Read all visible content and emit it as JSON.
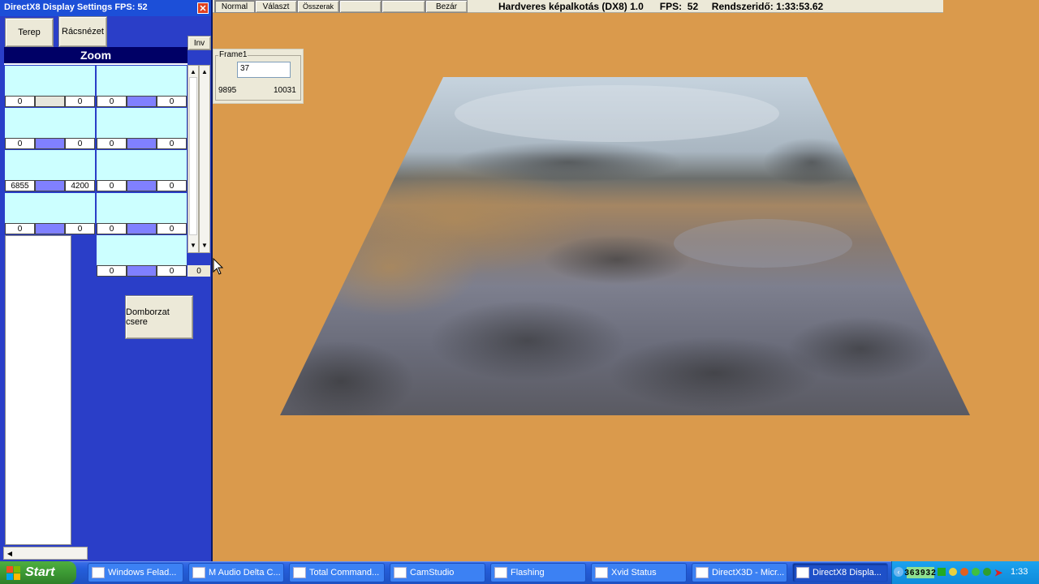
{
  "settings_window": {
    "title": "DirectX8 Display Settings FPS:  52",
    "btn_terep": "Terep",
    "btn_racsnezet": "Rácsnézet",
    "btn_inv": "Inv",
    "zoom_header": "Zoom",
    "rows": [
      [
        "0",
        "0",
        "0",
        "0"
      ],
      [
        "0",
        "0",
        "0",
        "0"
      ],
      [
        "6855",
        "4200",
        "0",
        "0"
      ],
      [
        "0",
        "0",
        "0",
        "0"
      ]
    ],
    "last_row": [
      "0",
      "0",
      "0"
    ],
    "btn_domborzat": "Domborzat csere"
  },
  "frame1": {
    "label": "Frame1",
    "input_value": "37",
    "left_value": "9895",
    "right_value": "10031"
  },
  "top_menu": {
    "normal": "Normal",
    "valaszt": "Választ",
    "osszerak": "Összerak",
    "bezar": "Bezár",
    "status": "Hardveres képalkotás (DX8) 1.0      FPS:  52     Rendszeridő: 1:33:53.62"
  },
  "taskbar": {
    "start": "Start",
    "items": [
      "Windows Felad...",
      "M Audio Delta C...",
      "Total Command...",
      "CamStudio",
      "Flashing",
      "Xvid Status",
      "DirectX3D - Micr...",
      "DirectX8 Displa..."
    ],
    "tray_counter": "363932",
    "clock": "1:33"
  },
  "colors": {
    "background": "#DA9A4C",
    "panel_blue": "#2A3EC8",
    "zoom_header_bg": "#000066",
    "cyan": "#CCFFFF",
    "taskbar": "#245EDB",
    "start_green": "#3C9A34"
  }
}
